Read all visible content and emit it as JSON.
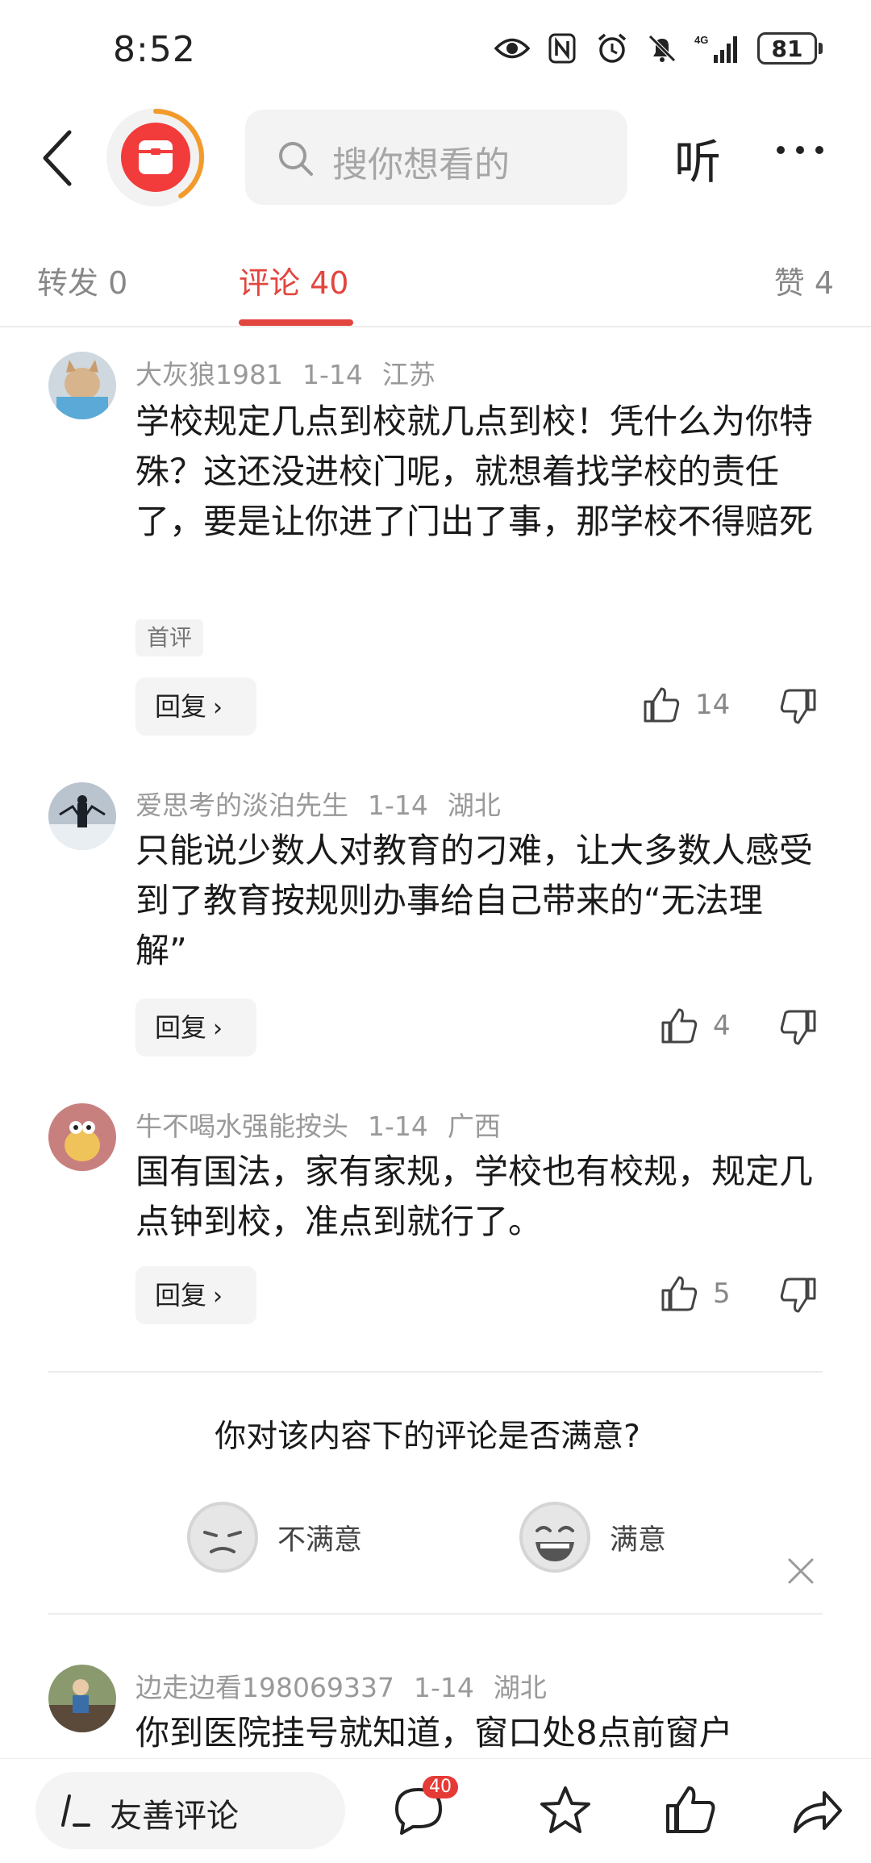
{
  "status_bar": {
    "time": "8:52",
    "battery": "81",
    "network": "4G"
  },
  "top_bar": {
    "search_placeholder": "搜你想看的",
    "listen_label": "听"
  },
  "tabs": {
    "repost": "转发 0",
    "comments": "评论 40",
    "likes": "赞 4"
  },
  "comments": [
    {
      "user": "大灰狼1981",
      "date": "1-14",
      "location": "江苏",
      "text": "学校规定几点到校就几点到校！凭什么为你特殊？这还没进校门呢，就想着找学校的责任了，要是让你进了门出了事，那学校不得赔死",
      "tag": "首评",
      "reply_label": "回复",
      "likes": "14"
    },
    {
      "user": "爱思考的淡泊先生",
      "date": "1-14",
      "location": "湖北",
      "text": "只能说少数人对教育的刁难，让大多数人感受到了教育按规则办事给自己带来的“无法理解”",
      "reply_label": "回复",
      "likes": "4"
    },
    {
      "user": "牛不喝水强能按头",
      "date": "1-14",
      "location": "广西",
      "text": "国有国法，家有家规，学校也有校规，规定几点钟到校，准点到就行了。",
      "reply_label": "回复",
      "likes": "5"
    },
    {
      "user": "边走边看198069337",
      "date": "1-14",
      "location": "湖北",
      "text": "你到医院挂号就知道，窗口处8点前窗户"
    }
  ],
  "survey": {
    "question": "你对该内容下的评论是否满意?",
    "unsatisfied": "不满意",
    "satisfied": "满意"
  },
  "bottom_bar": {
    "input_label": "友善评论",
    "comment_badge": "40"
  },
  "colors": {
    "accent": "#e2463f",
    "badge": "#e63a36",
    "logo": "#f23b3b"
  }
}
